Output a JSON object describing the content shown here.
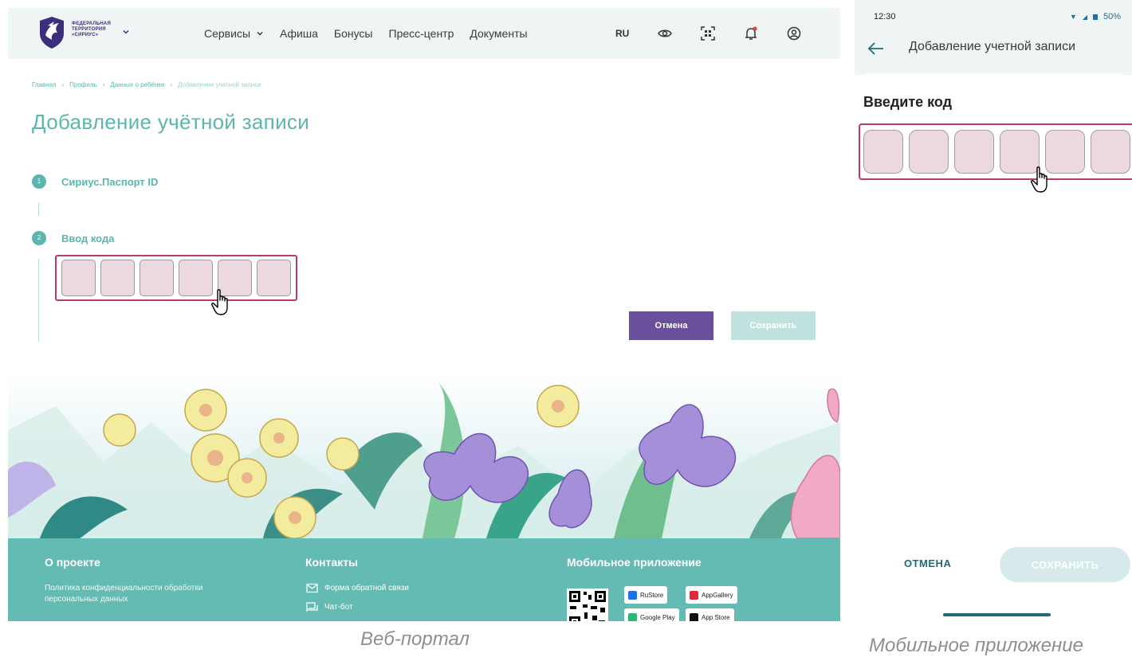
{
  "web": {
    "logo_text": [
      "ФЕДЕРАЛЬНАЯ",
      "ТЕРРИТОРИЯ",
      "«СИРИУС»"
    ],
    "nav": [
      "Сервисы",
      "Афиша",
      "Бонусы",
      "Пресс-центр",
      "Документы"
    ],
    "lang": "RU",
    "header_icons": [
      "eye-icon",
      "qr-scan-icon",
      "bell-icon",
      "profile-icon"
    ],
    "breadcrumb": [
      "Главная",
      "Профиль",
      "Данные о ребёнке",
      "Добавление учетной записи"
    ],
    "title": "Добавление учётной записи",
    "steps": [
      {
        "num": "1",
        "label": "Сириус.Паспорт ID"
      },
      {
        "num": "2",
        "label": "Ввод кода"
      }
    ],
    "code_cells": 6,
    "cancel_label": "Отмена",
    "save_label": "Сохранить",
    "footer": {
      "about_title": "О проекте",
      "about_text": "Политика конфиденциальности обработки персональных данных",
      "contacts_title": "Контакты",
      "contact_links": [
        "Форма обратной связи",
        "Чат-бот"
      ],
      "app_title": "Мобильное приложение",
      "stores": [
        "RuStore",
        "AppGallery",
        "Google Play",
        "App Store"
      ]
    }
  },
  "mobile": {
    "time": "12:30",
    "battery": "50%",
    "title": "Добавление учетной записи",
    "heading": "Введите код",
    "code_cells": 6,
    "cancel_label": "ОТМЕНА",
    "save_label": "СОХРАНИТЬ"
  },
  "captions": {
    "web": "Веб-портал",
    "mobile": "Мобильное приложение"
  },
  "colors": {
    "teal": "#5bb6ad",
    "purple": "#6a4f9c",
    "highlight": "#b83a6e",
    "cell": "#ecd8e0",
    "footer": "#64bbb3"
  }
}
